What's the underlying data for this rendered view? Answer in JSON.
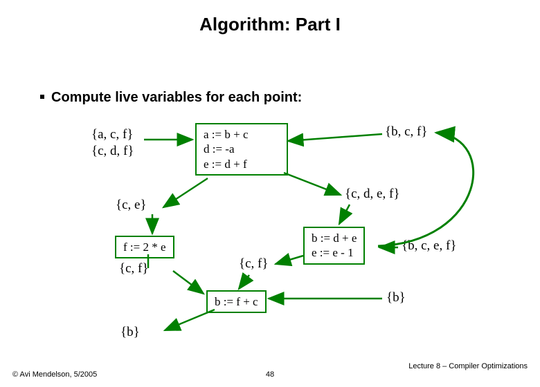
{
  "title": "Algorithm: Part I",
  "bullet": "Compute live variables for each point:",
  "node1": "a := b + c\nd := -a\ne := d + f",
  "node2": "f := 2 * e",
  "node3": "b := d + e\ne := e - 1",
  "node4": "b := f + c",
  "lbl_top_left1": "{a, c, f}",
  "lbl_top_left2": "{c, d, f}",
  "lbl_top_right": "{b, c, f}",
  "lbl_mid_right": "{c, d, e, f}",
  "lbl_ce": "{c, e}",
  "lbl_cf_mid": "{c, f}",
  "lbl_cf_left": "{c, f}",
  "lbl_bcef": "{b, c, e, f}",
  "lbl_b_right": "{b}",
  "lbl_b_bottom": "{b}",
  "footer_left": "© Avi Mendelson, 5/2005",
  "footer_right": "Lecture 8 – Compiler Optimizations",
  "page": "48",
  "chart_data": {
    "type": "diagram",
    "title": "Live-variable analysis flow graph",
    "nodes": [
      {
        "id": "n1",
        "code": [
          "a := b + c",
          "d := -a",
          "e := d + f"
        ],
        "in": "{a, c, f}",
        "out_left": "{c, e}",
        "out_right": "{c, d, e, f}",
        "loop_in": "{b, c, f}"
      },
      {
        "id": "n2",
        "code": [
          "f := 2 * e"
        ],
        "in": "{c, e}",
        "out": "{c, f}"
      },
      {
        "id": "n3",
        "code": [
          "b := d + e",
          "e := e - 1"
        ],
        "in": "{c, d, e, f}",
        "out": "{b, c, e, f}",
        "backedge_to": "n1"
      },
      {
        "id": "n4",
        "code": [
          "b := f + c"
        ],
        "in": "{c, f}",
        "out": "{b}"
      }
    ],
    "edges": [
      {
        "from": "n1",
        "to": "n2"
      },
      {
        "from": "n1",
        "to": "n3"
      },
      {
        "from": "n2",
        "to": "n4"
      },
      {
        "from": "n3",
        "to": "n4"
      },
      {
        "from": "n3",
        "to": "n1",
        "type": "back"
      }
    ]
  }
}
